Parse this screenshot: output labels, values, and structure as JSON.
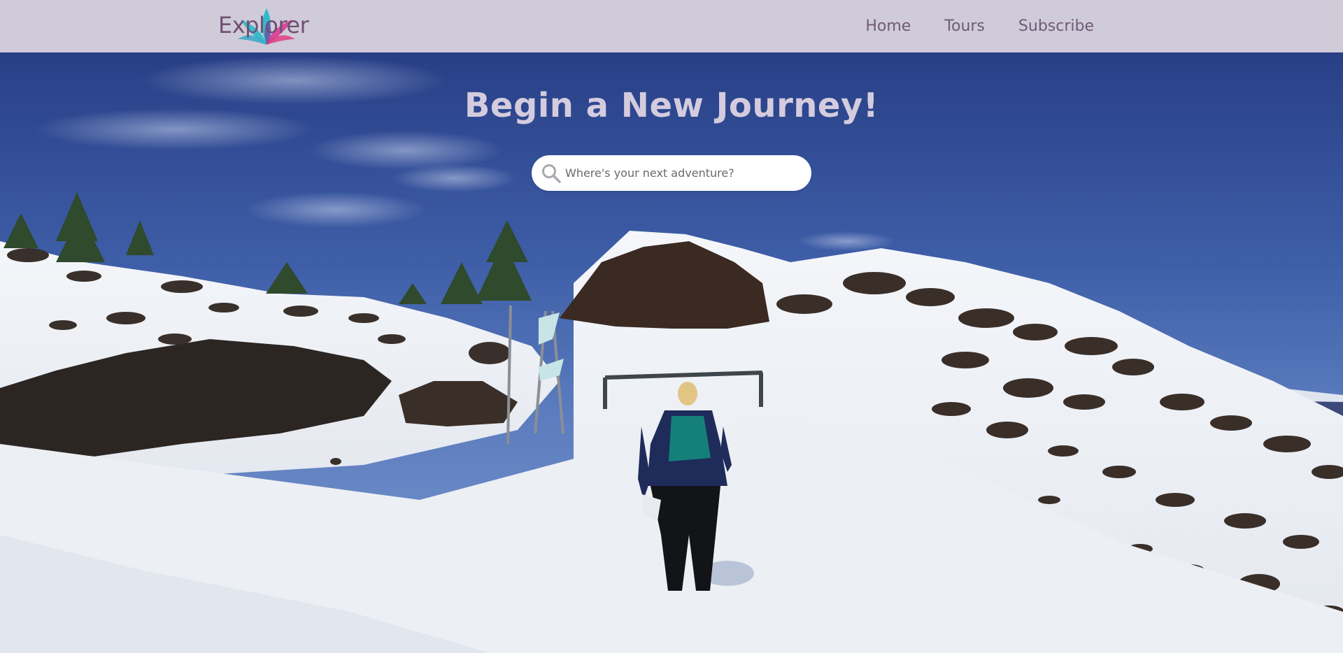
{
  "brand": {
    "name": "Explorer",
    "colors": {
      "text": "#6f4f74",
      "petal_teal": "#1fb8c8",
      "petal_magenta": "#d8348c",
      "navbar_bg": "#d0cbd8"
    }
  },
  "nav": {
    "items": [
      {
        "label": "Home"
      },
      {
        "label": "Tours"
      },
      {
        "label": "Subscribe"
      }
    ]
  },
  "hero": {
    "title": "Begin a New Journey!",
    "search": {
      "placeholder": "Where's your next adventure?",
      "value": "",
      "icon": "search-icon"
    },
    "background": "snowy volcanic hillside with hiker"
  }
}
